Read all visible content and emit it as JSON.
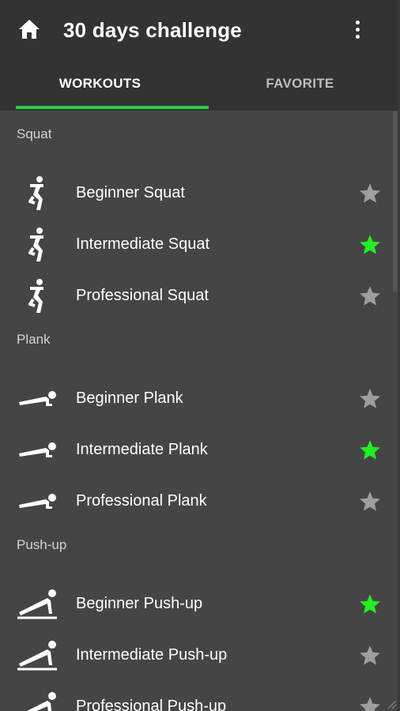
{
  "app": {
    "title": "30 days challenge",
    "home_icon": "home-icon",
    "menu_icon": "more-vertical-icon"
  },
  "tabs": [
    {
      "label": "WORKOUTS",
      "active": true
    },
    {
      "label": "FAVORITE",
      "active": false
    }
  ],
  "colors": {
    "accent": "#2ecc40",
    "star_on": "#22ee22",
    "star_off": "#9e9e9e",
    "background": "#454545",
    "toolbar": "#333333"
  },
  "sections": [
    {
      "header": "Squat",
      "icon": "squat-icon",
      "items": [
        {
          "label": "Beginner Squat",
          "favorite": false
        },
        {
          "label": "Intermediate Squat",
          "favorite": true
        },
        {
          "label": "Professional Squat",
          "favorite": false
        }
      ]
    },
    {
      "header": "Plank",
      "icon": "plank-icon",
      "items": [
        {
          "label": "Beginner Plank",
          "favorite": false
        },
        {
          "label": "Intermediate Plank",
          "favorite": true
        },
        {
          "label": "Professional Plank",
          "favorite": false
        }
      ]
    },
    {
      "header": "Push-up",
      "icon": "pushup-icon",
      "items": [
        {
          "label": "Beginner Push-up",
          "favorite": true
        },
        {
          "label": "Intermediate Push-up",
          "favorite": false
        },
        {
          "label": "Professional Push-up",
          "favorite": false
        }
      ]
    }
  ]
}
